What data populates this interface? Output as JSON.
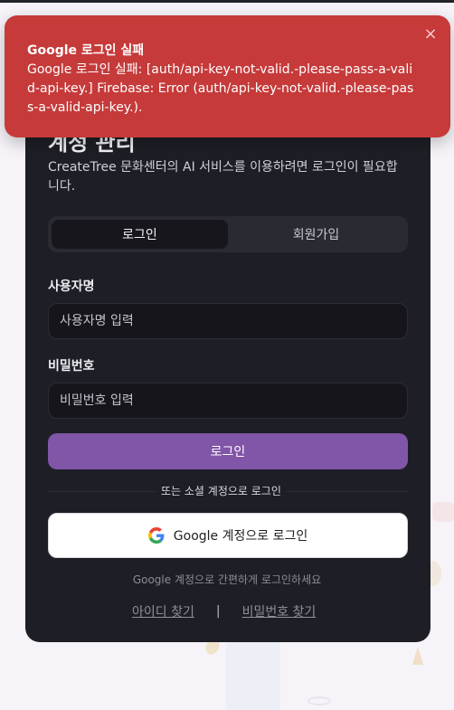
{
  "page": {
    "title": "계정 관리",
    "description": "CreateTree 문화센터의 AI 서비스를 이용하려면 로그인이 필요합니다."
  },
  "tabs": [
    {
      "label": "로그인",
      "active": true
    },
    {
      "label": "회원가입",
      "active": false
    }
  ],
  "form": {
    "username_label": "사용자명",
    "username_placeholder": "사용자명 입력",
    "password_label": "비밀번호",
    "password_placeholder": "비밀번호 입력",
    "login_button": "로그인"
  },
  "social": {
    "divider_text": "또는 소셜 계정으로 로그인",
    "google_button": "Google 계정으로 로그인",
    "google_icon": "google-g-icon",
    "hint": "Google 계정으로 간편하게 로그인하세요"
  },
  "links": {
    "find_id": "아이디 찾기",
    "separator": "|",
    "find_password": "비밀번호 찾기"
  },
  "toast": {
    "title": "Google 로그인 실패",
    "message": "Google 로그인 실패: [auth/api-key-not-valid.-please-pass-a-valid-api-key.] Firebase: Error (auth/api-key-not-valid.-please-pass-a-valid-api-key.).",
    "close_icon": "close-icon",
    "color": "#c63a3a"
  },
  "colors": {
    "card_bg": "#1e1e26",
    "accent": "#8155a7"
  }
}
